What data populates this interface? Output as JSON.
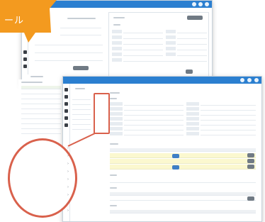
{
  "banner": {
    "label": "ール"
  },
  "back_window": {
    "title": ""
  },
  "front_window": {
    "title": ""
  },
  "menu": {
    "items": [
      {
        "label": "",
        "active": true
      },
      {
        "label": "",
        "active": false
      },
      {
        "label": "",
        "active": false
      },
      {
        "label": "",
        "active": false
      },
      {
        "label": "",
        "active": false
      },
      {
        "label": "",
        "active": false
      },
      {
        "label": "",
        "active": false
      },
      {
        "label": "",
        "active": false
      },
      {
        "label": "",
        "active": false
      }
    ]
  },
  "colors": {
    "accent_orange": "#f39a1f",
    "highlight_red": "#d9614c",
    "topbar_blue": "#2b7fd0",
    "row_yellow": "#fbf8cf"
  }
}
